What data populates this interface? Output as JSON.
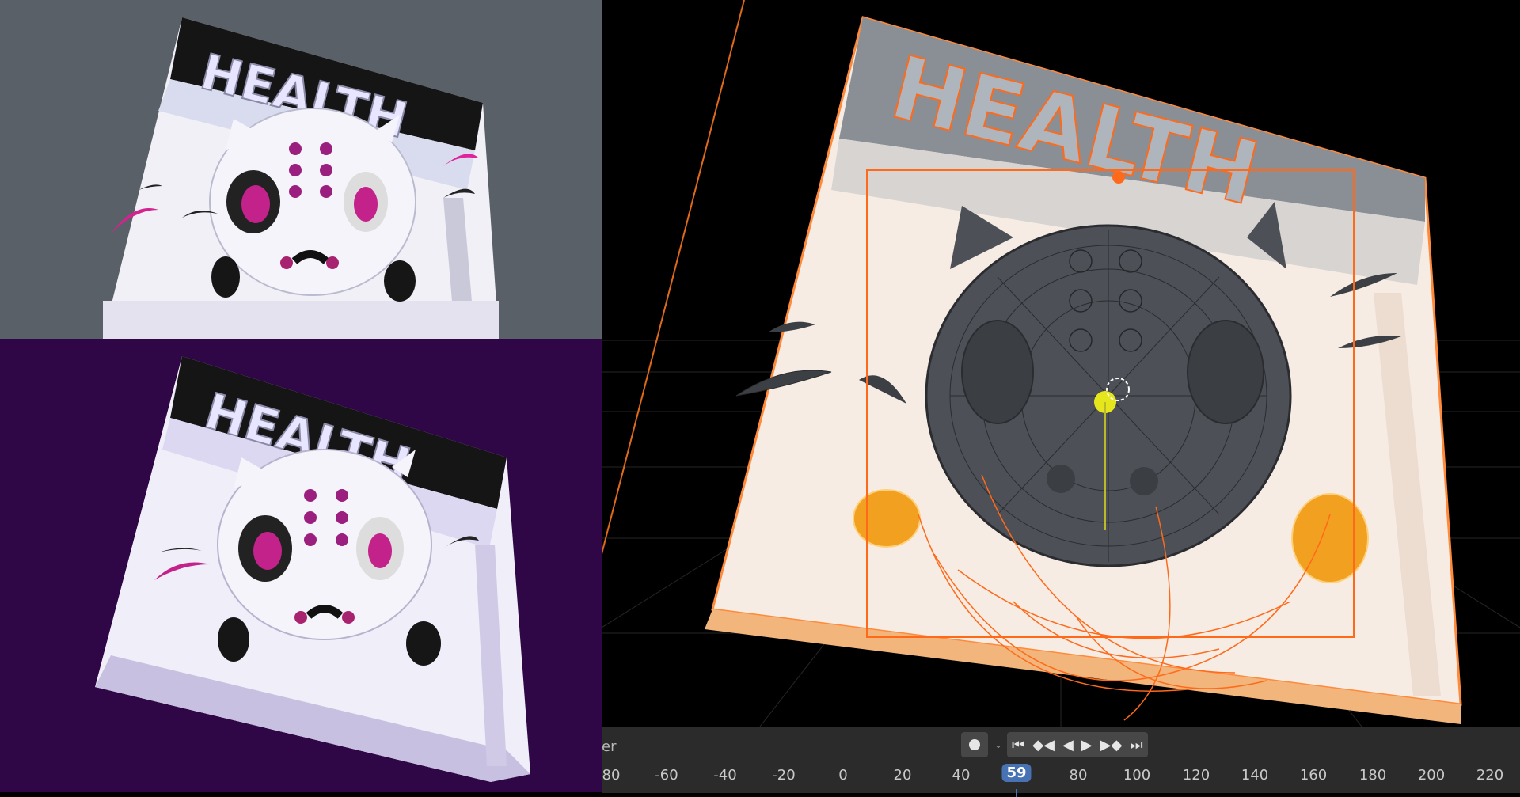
{
  "renders": {
    "top_sign_text": "HEALTH",
    "bottom_sign_text": "HEALTH"
  },
  "viewport": {
    "sign_text": "HEALTH"
  },
  "timeline": {
    "editor_label": "er",
    "current_frame": "59",
    "ticks": [
      "80",
      "-60",
      "-40",
      "-20",
      "0",
      "20",
      "40",
      "80",
      "100",
      "120",
      "140",
      "160",
      "180",
      "200",
      "220"
    ],
    "buttons": [
      "record-icon",
      "dropdown-icon",
      "jump-start-icon",
      "prev-keyframe-icon",
      "play-reverse-icon",
      "play-icon",
      "next-keyframe-icon",
      "jump-end-icon"
    ]
  },
  "colors": {
    "render_top_bg": "#596068",
    "render_bottom_bg": "#2f0746",
    "accent_magenta": "#c2228a",
    "selection_orange": "#ff6a1a",
    "playhead_blue": "#4772b3"
  }
}
